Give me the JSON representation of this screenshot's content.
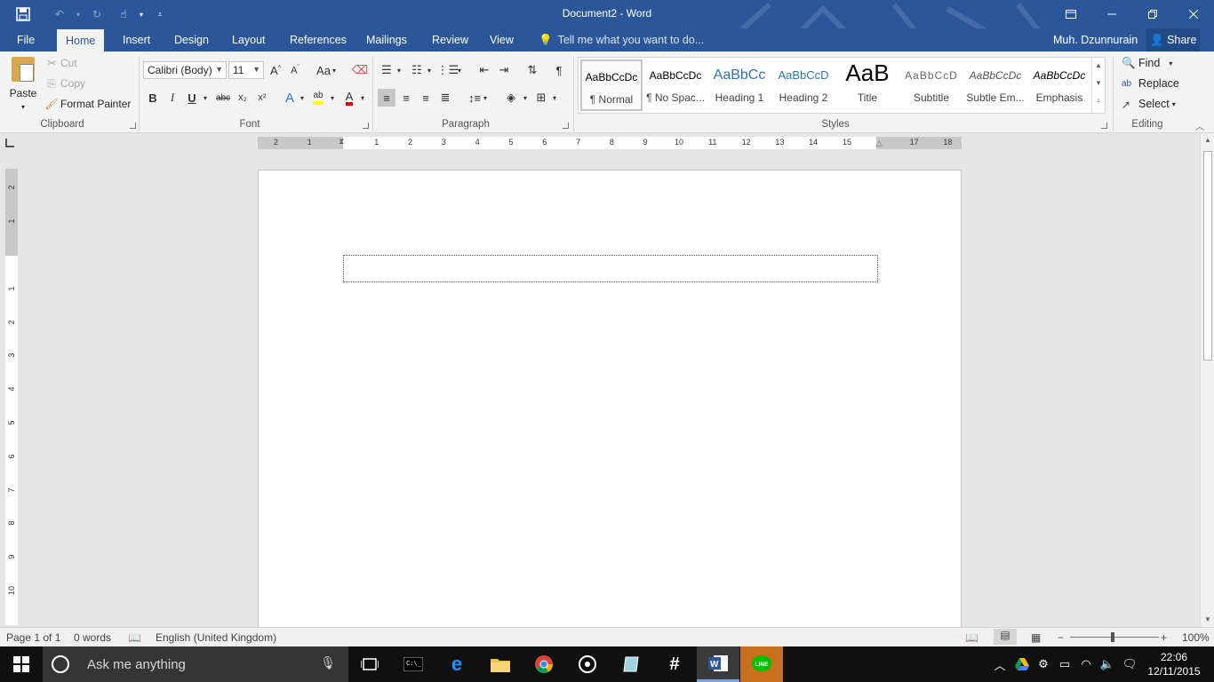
{
  "window": {
    "title": "Document2 - Word",
    "user": "Muh. Dzunnurain",
    "share": "Share",
    "tell_me": "Tell me what you want to do..."
  },
  "tabs": [
    "File",
    "Home",
    "Insert",
    "Design",
    "Layout",
    "References",
    "Mailings",
    "Review",
    "View"
  ],
  "active_tab": "Home",
  "clipboard": {
    "paste": "Paste",
    "cut": "Cut",
    "copy": "Copy",
    "format_painter": "Format Painter",
    "label": "Clipboard"
  },
  "font": {
    "family": "Calibri (Body)",
    "size": "11",
    "label": "Font",
    "change_case": "Aa",
    "bold": "B",
    "italic": "I",
    "underline": "U",
    "strike": "abc",
    "subscript": "x₂",
    "superscript": "x²"
  },
  "paragraph": {
    "label": "Paragraph"
  },
  "styles": {
    "label": "Styles",
    "items": [
      {
        "sample": "AaBbCcDc",
        "name": "¶ Normal"
      },
      {
        "sample": "AaBbCcDc",
        "name": "¶ No Spac..."
      },
      {
        "sample": "AaBbCc",
        "name": "Heading 1"
      },
      {
        "sample": "AaBbCcD",
        "name": "Heading 2"
      },
      {
        "sample": "AaB",
        "name": "Title"
      },
      {
        "sample": "AaBbCcD",
        "name": "Subtitle"
      },
      {
        "sample": "AaBbCcDc",
        "name": "Subtle Em..."
      },
      {
        "sample": "AaBbCcDc",
        "name": "Emphasis"
      }
    ]
  },
  "editing": {
    "find": "Find",
    "replace": "Replace",
    "select": "Select",
    "label": "Editing"
  },
  "ruler": {
    "h_numbers": [
      "2",
      "1",
      "1",
      "2",
      "3",
      "4",
      "5",
      "6",
      "7",
      "8",
      "9",
      "10",
      "11",
      "12",
      "13",
      "14",
      "15",
      "17",
      "18"
    ],
    "v_numbers": [
      "2",
      "1",
      "1",
      "2",
      "3",
      "4",
      "5",
      "6",
      "7",
      "8",
      "9",
      "10",
      "11"
    ]
  },
  "status": {
    "page": "Page 1 of 1",
    "words": "0 words",
    "language": "English (United Kingdom)",
    "zoom": "100%",
    "zoom_level": 1.0
  },
  "taskbar": {
    "search": "Ask me anything",
    "time": "22:06",
    "date": "12/11/2015",
    "line_label": "LINE"
  },
  "colors": {
    "word_blue": "#2b579a",
    "ribbon_bg": "#f3f3f3",
    "taskbar_bg": "#101010",
    "line_app": "#c7701d"
  }
}
